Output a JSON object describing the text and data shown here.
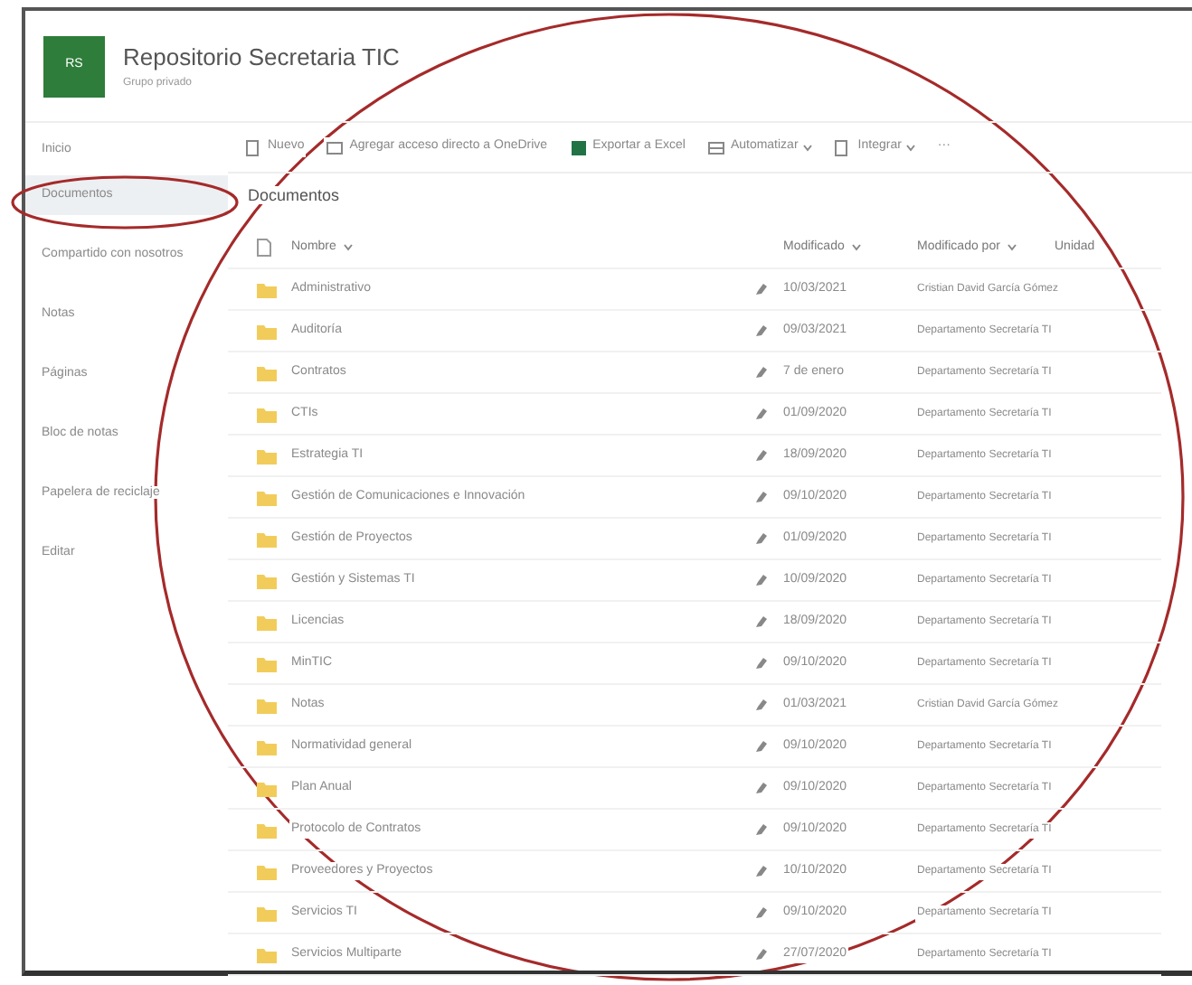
{
  "site": {
    "logo": "RS",
    "title": "Repositorio Secretaria TIC",
    "subtitle": "Grupo privado"
  },
  "sidebar": {
    "home": "Inicio",
    "items": [
      {
        "label": "Documentos",
        "selected": true
      },
      {
        "label": "Compartido con nosotros",
        "selected": false
      },
      {
        "label": "Notas",
        "selected": false
      },
      {
        "label": "Páginas",
        "selected": false
      },
      {
        "label": "Bloc de notas",
        "selected": false
      },
      {
        "label": "Papelera de reciclaje",
        "selected": false
      },
      {
        "label": "Editar",
        "selected": false
      }
    ]
  },
  "toolbar": [
    {
      "label": "Nuevo",
      "kind": "new",
      "caret": false
    },
    {
      "label": "Agregar acceso directo a OneDrive",
      "kind": "shortcut",
      "caret": false
    },
    {
      "label": "Exportar a Excel",
      "kind": "excel",
      "caret": false
    },
    {
      "label": "Automatizar",
      "kind": "flow",
      "caret": true
    },
    {
      "label": "Integrar",
      "kind": "integrate",
      "caret": true
    },
    {
      "label": "···",
      "kind": "more",
      "caret": false
    }
  ],
  "library": {
    "title": "Documentos",
    "columns": [
      {
        "label": "Nombre",
        "sortable": true
      },
      {
        "label": "Modificado",
        "sortable": true
      },
      {
        "label": "Modificado por",
        "sortable": true
      },
      {
        "label": "Unidad",
        "sortable": false
      }
    ],
    "rows": [
      {
        "name": "Administrativo",
        "modified": "10/03/2021",
        "modified_by": "Cristian David García Gómez"
      },
      {
        "name": "Auditoría",
        "modified": "09/03/2021",
        "modified_by": "Departamento Secretaría TI"
      },
      {
        "name": "Contratos",
        "modified": "7 de enero",
        "modified_by": "Departamento Secretaría TI"
      },
      {
        "name": "CTIs",
        "modified": "01/09/2020",
        "modified_by": "Departamento Secretaría TI"
      },
      {
        "name": "Estrategia TI",
        "modified": "18/09/2020",
        "modified_by": "Departamento Secretaría TI"
      },
      {
        "name": "Gestión de Comunicaciones e Innovación",
        "modified": "09/10/2020",
        "modified_by": "Departamento Secretaría TI"
      },
      {
        "name": "Gestión de Proyectos",
        "modified": "01/09/2020",
        "modified_by": "Departamento Secretaría TI"
      },
      {
        "name": "Gestión y Sistemas TI",
        "modified": "10/09/2020",
        "modified_by": "Departamento Secretaría TI"
      },
      {
        "name": "Licencias",
        "modified": "18/09/2020",
        "modified_by": "Departamento Secretaría TI"
      },
      {
        "name": "MinTIC",
        "modified": "09/10/2020",
        "modified_by": "Departamento Secretaría TI"
      },
      {
        "name": "Notas",
        "modified": "01/03/2021",
        "modified_by": "Cristian David García Gómez"
      },
      {
        "name": "Normatividad general",
        "modified": "09/10/2020",
        "modified_by": "Departamento Secretaría TI"
      },
      {
        "name": "Plan Anual",
        "modified": "09/10/2020",
        "modified_by": "Departamento Secretaría TI"
      },
      {
        "name": "Protocolo de Contratos",
        "modified": "09/10/2020",
        "modified_by": "Departamento Secretaría TI"
      },
      {
        "name": "Proveedores y Proyectos",
        "modified": "10/10/2020",
        "modified_by": "Departamento Secretaría TI"
      },
      {
        "name": "Servicios TI",
        "modified": "09/10/2020",
        "modified_by": "Departamento Secretaría TI"
      },
      {
        "name": "Servicios Multiparte",
        "modified": "27/07/2020",
        "modified_by": "Departamento Secretaría TI"
      }
    ]
  }
}
